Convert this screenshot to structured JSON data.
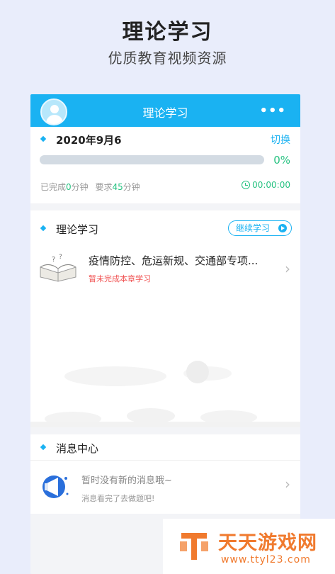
{
  "hero": {
    "title": "理论学习",
    "subtitle": "优质教育视频资源"
  },
  "topbar": {
    "title": "理论学习",
    "more": "•••"
  },
  "progress_card": {
    "date": "2020年9月6",
    "switch_label": "切换",
    "percent_label": "0%",
    "progress_fraction": 0,
    "completed_prefix": "已完成",
    "completed_minutes": "0",
    "minutes_unit": "分钟",
    "required_prefix": "要求",
    "required_minutes": "45",
    "timer": "00:00:00"
  },
  "study": {
    "section_title": "理论学习",
    "continue_label": "继续学习",
    "chapter": {
      "title": "疫情防控、危运新规、交通部专项...",
      "status": "暂未完成本章学习"
    }
  },
  "messages": {
    "section_title": "消息中心",
    "empty_text": "暂时没有新的消息哦~",
    "hint": "消息看完了去做题吧!"
  },
  "watermark": {
    "text": "天天游戏网",
    "url": "www.ttyl23.com"
  },
  "colors": {
    "accent": "#1ab2f2",
    "green": "#26c281",
    "red": "#f05252",
    "watermark": "#f07a2e"
  }
}
